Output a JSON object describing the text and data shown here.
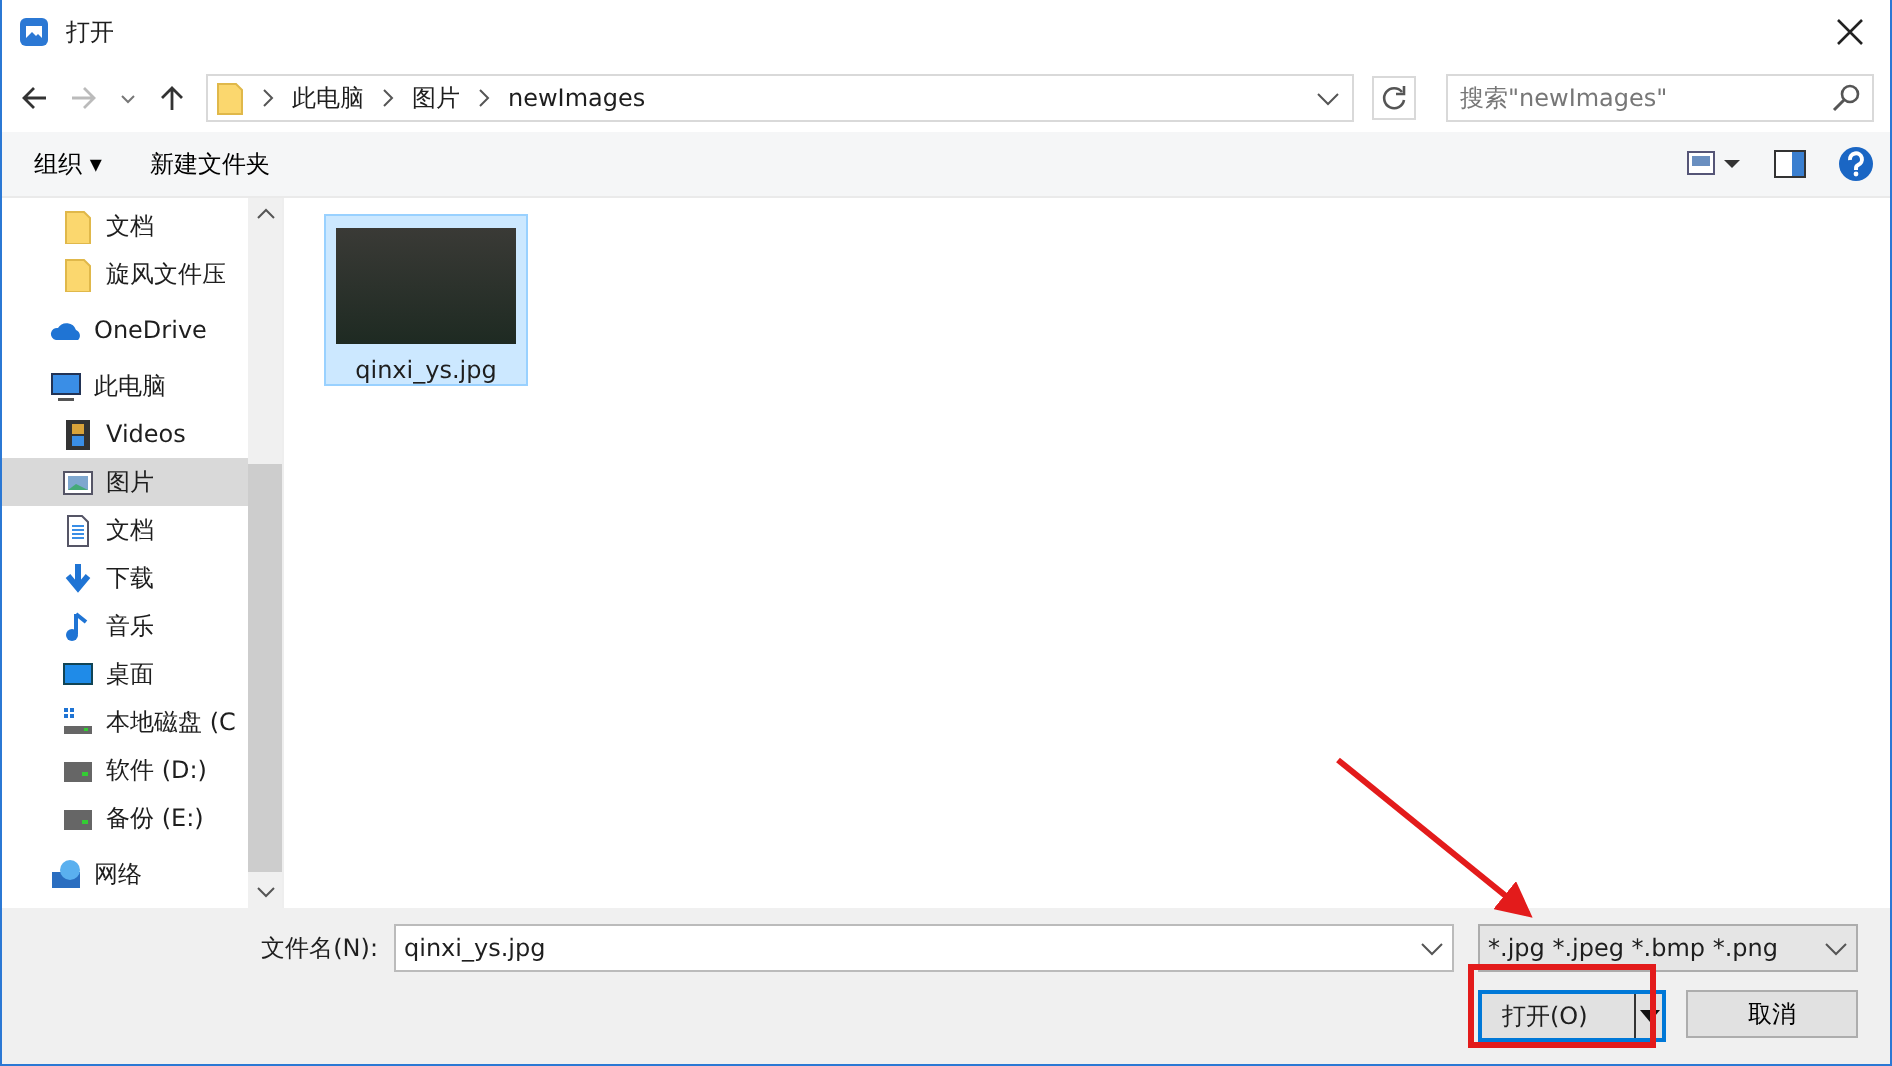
{
  "window": {
    "title": "打开"
  },
  "address": {
    "crumbs": [
      "此电脑",
      "图片",
      "newImages"
    ],
    "search_placeholder": "搜索\"newImages\""
  },
  "toolbar": {
    "organize": "组织 ▾",
    "new_folder": "新建文件夹"
  },
  "sidebar": {
    "pinned": [
      {
        "kind": "folder",
        "label": "文档",
        "selected": false
      },
      {
        "kind": "folder",
        "label": "旋风文件压",
        "selected": false
      }
    ],
    "items": [
      {
        "kind": "cloud",
        "label": "OneDrive",
        "selected": false
      },
      {
        "kind": "pc",
        "label": "此电脑",
        "selected": false,
        "children": [
          {
            "kind": "video",
            "label": "Videos",
            "selected": false
          },
          {
            "kind": "picture",
            "label": "图片",
            "selected": true
          },
          {
            "kind": "doc",
            "label": "文档",
            "selected": false
          },
          {
            "kind": "download",
            "label": "下载",
            "selected": false
          },
          {
            "kind": "music",
            "label": "音乐",
            "selected": false
          },
          {
            "kind": "desktop",
            "label": "桌面",
            "selected": false
          },
          {
            "kind": "sysdrive",
            "label": "本地磁盘 (C",
            "selected": false
          },
          {
            "kind": "drive",
            "label": "软件 (D:)",
            "selected": false
          },
          {
            "kind": "drive",
            "label": "备份 (E:)",
            "selected": false
          }
        ]
      },
      {
        "kind": "network",
        "label": "网络",
        "selected": false
      }
    ]
  },
  "files": [
    {
      "name": "qinxi_ys.jpg",
      "selected": true
    }
  ],
  "footer": {
    "filename_label": "文件名(N):",
    "filename": "qinxi_ys.jpg",
    "filter": "*.jpg *.jpeg *.bmp *.png",
    "open": "打开(O)",
    "cancel": "取消"
  }
}
